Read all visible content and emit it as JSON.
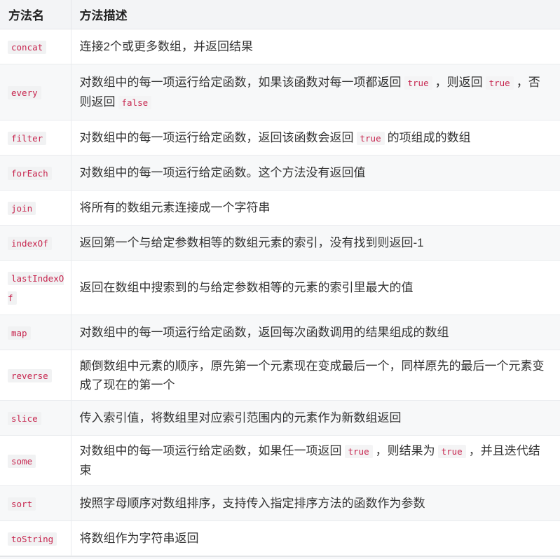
{
  "header": {
    "col1": "方法名",
    "col2": "方法描述"
  },
  "rows": [
    {
      "name": "concat",
      "height": 50,
      "desc": [
        {
          "t": "text",
          "v": "连接2个或更多数组，并返回结果"
        }
      ]
    },
    {
      "name": "every",
      "height": 80,
      "desc": [
        {
          "t": "text",
          "v": "对数组中的每一项运行给定函数，如果该函数对每一项都返回"
        },
        {
          "t": "code",
          "v": "true"
        },
        {
          "t": "text",
          "v": "，则返回"
        },
        {
          "t": "code",
          "v": "true"
        },
        {
          "t": "text",
          "v": "，否则返回"
        },
        {
          "t": "code",
          "v": "false"
        }
      ]
    },
    {
      "name": "filter",
      "height": 50,
      "desc": [
        {
          "t": "text",
          "v": "对数组中的每一项运行给定函数，返回该函数会返回"
        },
        {
          "t": "code",
          "v": "true"
        },
        {
          "t": "text",
          "v": "的项组成的数组"
        }
      ]
    },
    {
      "name": "forEach",
      "height": 50,
      "desc": [
        {
          "t": "text",
          "v": "对数组中的每一项运行给定函数。这个方法没有返回值"
        }
      ]
    },
    {
      "name": "join",
      "height": 50,
      "desc": [
        {
          "t": "text",
          "v": "将所有的数组元素连接成一个字符串"
        }
      ]
    },
    {
      "name": "indexOf",
      "height": 50,
      "desc": [
        {
          "t": "text",
          "v": "返回第一个与给定参数相等的数组元素的索引，没有找到则返回-1"
        }
      ]
    },
    {
      "name": "lastIndexOf",
      "height": 78,
      "desc": [
        {
          "t": "text",
          "v": "返回在数组中搜索到的与给定参数相等的元素的索引里最大的值"
        }
      ]
    },
    {
      "name": "map",
      "height": 50,
      "desc": [
        {
          "t": "text",
          "v": "对数组中的每一项运行给定函数，返回每次函数调用的结果组成的数组"
        }
      ]
    },
    {
      "name": "reverse",
      "height": 72,
      "desc": [
        {
          "t": "text",
          "v": "颠倒数组中元素的顺序，原先第一个元素现在变成最后一个，同样原先的最后一个元素变成了现在的第一个"
        }
      ]
    },
    {
      "name": "slice",
      "height": 50,
      "desc": [
        {
          "t": "text",
          "v": "传入索引值，将数组里对应索引范围内的元素作为新数组返回"
        }
      ]
    },
    {
      "name": "some",
      "height": 72,
      "desc": [
        {
          "t": "text",
          "v": "对数组中的每一项运行给定函数，如果任一项返回"
        },
        {
          "t": "code",
          "v": "true"
        },
        {
          "t": "text",
          "v": "，则结果为"
        },
        {
          "t": "code",
          "v": "true"
        },
        {
          "t": "text",
          "v": "，并且迭代结束"
        }
      ]
    },
    {
      "name": "sort",
      "height": 50,
      "desc": [
        {
          "t": "text",
          "v": "按照字母顺序对数组排序，支持传入指定排序方法的函数作为参数"
        }
      ]
    },
    {
      "name": "toString",
      "height": 50,
      "desc": [
        {
          "t": "text",
          "v": "将数组作为字符串返回"
        }
      ]
    }
  ]
}
